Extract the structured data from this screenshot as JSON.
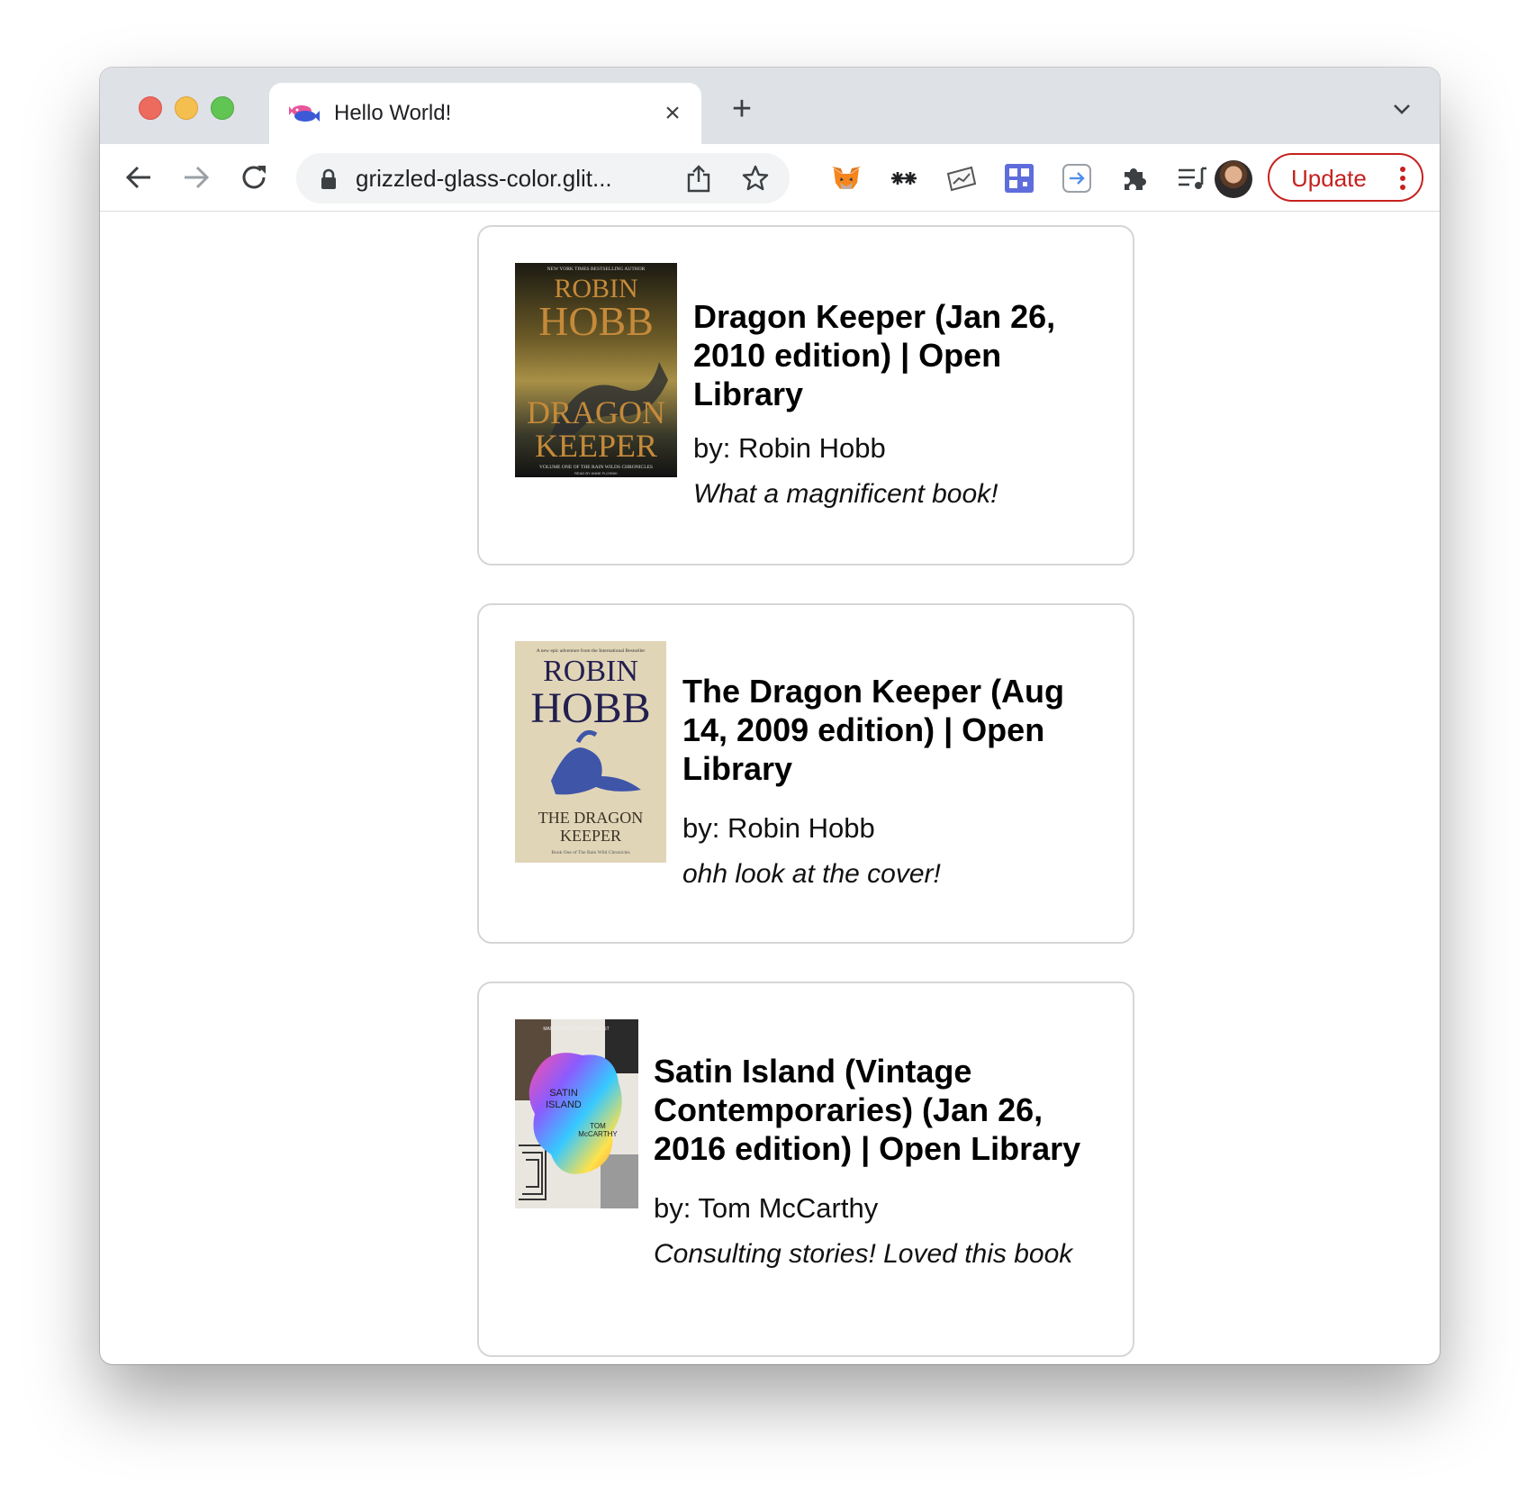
{
  "browser": {
    "tab_title": "Hello World!",
    "url": "grizzled-glass-color.glit...",
    "update_label": "Update"
  },
  "colors": {
    "update_accent": "#c5221f",
    "card_border": "#d6d6d6",
    "tab_strip": "#dee1e6"
  },
  "icons": [
    "back-arrow-icon",
    "forward-arrow-icon",
    "reload-icon",
    "lock-icon",
    "share-icon",
    "bookmark-star-icon",
    "metamask-fox-icon",
    "sparkle-extension-icon",
    "chart-extension-icon",
    "grid-extension-icon",
    "arrow-box-extension-icon",
    "puzzle-extensions-icon",
    "media-queue-icon",
    "more-vertical-icon",
    "close-icon",
    "plus-icon",
    "chevron-down-icon"
  ],
  "books": [
    {
      "title": "Dragon Keeper (Jan 26, 2010 edition) | Open Library",
      "author": "by: Robin Hobb",
      "review": "What a magnificent book!",
      "cover": {
        "top_text": "NEW YORK TIMES BESTSELLING AUTHOR",
        "author_line1": "ROBIN",
        "author_line2": "HOBB",
        "title_line1": "DRAGON",
        "title_line2": "KEEPER",
        "bottom_text": "VOLUME ONE OF THE RAIN WILDS CHRONICLES",
        "narrator": "READ BY ANNE FLOSNIK"
      }
    },
    {
      "title": "The Dragon Keeper (Aug 14, 2009 edition) | Open Library",
      "author": "by: Robin Hobb",
      "review": "ohh look at the cover!",
      "cover": {
        "top_text": "A new epic adventure from the International Bestseller",
        "author_line1": "ROBIN",
        "author_line2": "HOBB",
        "title_line1": "THE DRAGON",
        "title_line2": "KEEPER",
        "bottom_text": "Book One of The Rain Wild Chronicles"
      }
    },
    {
      "title": "Satin Island (Vintage Contemporaries) (Jan 26, 2016 edition) | Open Library",
      "author": "by: Tom McCarthy",
      "review": "Consulting stories! Loved this book",
      "cover": {
        "top_text": "MAN BOOKER PRIZE FINALIST",
        "title_line1": "SATIN",
        "title_line2": "ISLAND",
        "author_line1": "TOM",
        "author_line2": "McCARTHY"
      }
    }
  ]
}
